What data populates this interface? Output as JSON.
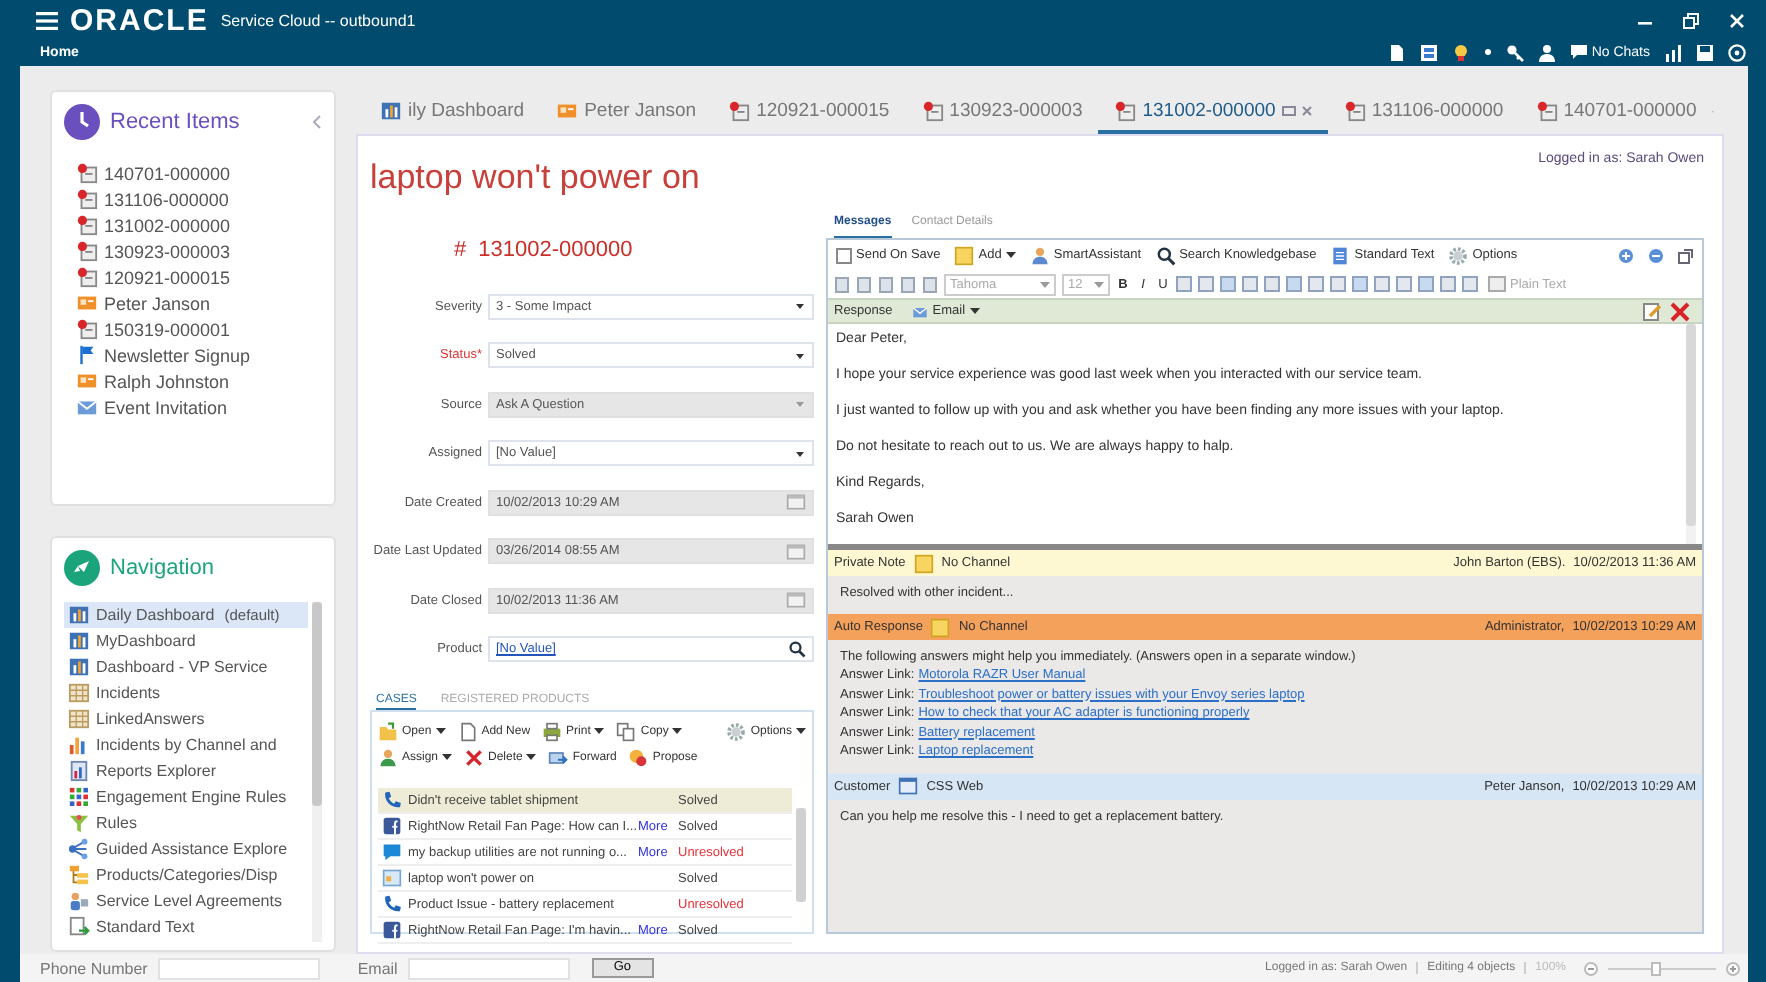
{
  "app": {
    "logo": "ORACLE",
    "title": "Service Cloud -- outbound1",
    "menu": "Home",
    "chat_status": "No Chats"
  },
  "recent_items": {
    "title": "Recent Items",
    "items": [
      {
        "kind": "incident",
        "label": "140701-000000"
      },
      {
        "kind": "incident",
        "label": "131106-000000"
      },
      {
        "kind": "incident",
        "label": "131002-000000"
      },
      {
        "kind": "incident",
        "label": "130923-000003"
      },
      {
        "kind": "incident",
        "label": "120921-000015"
      },
      {
        "kind": "contact",
        "label": "Peter Janson"
      },
      {
        "kind": "incident",
        "label": "150319-000001"
      },
      {
        "kind": "flag",
        "label": "Newsletter Signup"
      },
      {
        "kind": "contact",
        "label": "Ralph Johnston"
      },
      {
        "kind": "mail",
        "label": "Event Invitation"
      }
    ]
  },
  "navigation": {
    "title": "Navigation",
    "items": [
      {
        "kind": "dashboard",
        "label": "Daily Dashboard",
        "note": "(default)",
        "selected": true
      },
      {
        "kind": "dashboard",
        "label": "MyDashboard",
        "selected": false
      },
      {
        "kind": "dashboard",
        "label": "Dashboard - VP Service",
        "selected": false
      },
      {
        "kind": "table",
        "label": "Incidents",
        "selected": false
      },
      {
        "kind": "table",
        "label": "LinkedAnswers",
        "selected": false
      },
      {
        "kind": "chart",
        "label": "Incidents by Channel and",
        "selected": false
      },
      {
        "kind": "report",
        "label": "Reports Explorer",
        "selected": false
      },
      {
        "kind": "grid",
        "label": "Engagement Engine Rules",
        "selected": false
      },
      {
        "kind": "funnel",
        "label": "Rules",
        "selected": false
      },
      {
        "kind": "network",
        "label": "Guided Assistance Explore",
        "selected": false
      },
      {
        "kind": "hierarchy",
        "label": "Products/Categories/Disp",
        "selected": false
      },
      {
        "kind": "people",
        "label": "Service Level Agreements",
        "selected": false
      },
      {
        "kind": "textdoc",
        "label": "Standard Text",
        "selected": false
      }
    ]
  },
  "tabs": [
    {
      "kind": "dashboard",
      "label": "ily Dashboard",
      "selected": false
    },
    {
      "kind": "contact",
      "label": "Peter Janson",
      "selected": false
    },
    {
      "kind": "incident",
      "label": "120921-000015",
      "selected": false
    },
    {
      "kind": "incident",
      "label": "130923-000003",
      "selected": false
    },
    {
      "kind": "incident",
      "label": "131002-000000",
      "selected": true
    },
    {
      "kind": "incident",
      "label": "131106-000000",
      "selected": false
    },
    {
      "kind": "incident",
      "label": "140701-000000",
      "selected": false
    }
  ],
  "incident": {
    "subject": "laptop won't power on",
    "logged_in": "Logged in as: Sarah Owen",
    "number_mark": "#",
    "number": "131002-000000",
    "fields": [
      {
        "label": "Severity",
        "value": "3 - Some Impact",
        "kind": "select",
        "required": false,
        "disabled": false
      },
      {
        "label": "Status*",
        "value": "Solved",
        "kind": "select",
        "required": true,
        "disabled": false
      },
      {
        "label": "Source",
        "value": "Ask A Question",
        "kind": "select",
        "required": false,
        "disabled": true
      },
      {
        "label": "Assigned",
        "value": "[No Value]",
        "kind": "select",
        "required": false,
        "disabled": false
      },
      {
        "label": "Date Created",
        "value": "10/02/2013 10:29 AM",
        "kind": "date",
        "required": false,
        "disabled": true
      },
      {
        "label": "Date Last Updated",
        "value": "03/26/2014 08:55 AM",
        "kind": "date",
        "required": false,
        "disabled": true
      },
      {
        "label": "Date Closed",
        "value": "10/02/2013 11:36 AM",
        "kind": "date",
        "required": false,
        "disabled": true
      },
      {
        "label": "Product",
        "value": "[No Value]",
        "kind": "lookup",
        "required": false,
        "disabled": false
      }
    ]
  },
  "cases": {
    "tabs": [
      {
        "label": "CASES",
        "selected": true
      },
      {
        "label": "REGISTERED PRODUCTS",
        "selected": false
      }
    ],
    "toolbar": [
      [
        {
          "kind": "open",
          "label": "Open",
          "dropdown": true
        },
        {
          "kind": "new",
          "label": "Add New",
          "dropdown": false
        },
        {
          "kind": "print",
          "label": "Print",
          "dropdown": true
        },
        {
          "kind": "copy",
          "label": "Copy",
          "dropdown": true
        },
        {
          "kind": "options",
          "label": "Options",
          "dropdown": true
        }
      ],
      [
        {
          "kind": "assign",
          "label": "Assign",
          "dropdown": true
        },
        {
          "kind": "delete",
          "label": "Delete",
          "dropdown": true
        },
        {
          "kind": "forward",
          "label": "Forward",
          "dropdown": false
        },
        {
          "kind": "propose",
          "label": "Propose",
          "dropdown": false
        }
      ]
    ],
    "rows": [
      {
        "kind": "phone",
        "subject": "Didn't receive tablet shipment",
        "status": "Solved",
        "resolved": true,
        "selected": true
      },
      {
        "kind": "social",
        "subject": "RightNow Retail Fan Page: How can I...",
        "more": "More",
        "status": "Solved",
        "resolved": true,
        "selected": false
      },
      {
        "kind": "chat",
        "subject": "my backup utilities are not running o...",
        "more": "More",
        "status": "Unresolved",
        "resolved": false,
        "selected": false
      },
      {
        "kind": "web",
        "subject": "laptop won't power on",
        "status": "Solved",
        "resolved": true,
        "selected": false
      },
      {
        "kind": "phone",
        "subject": "Product Issue - battery replacement",
        "status": "Unresolved",
        "resolved": false,
        "selected": false
      },
      {
        "kind": "social",
        "subject": "RightNow Retail Fan Page: I'm havin...",
        "more": "More",
        "status": "Solved",
        "resolved": true,
        "selected": false
      }
    ]
  },
  "messages": {
    "tabs": [
      {
        "label": "Messages",
        "selected": true
      },
      {
        "label": "Contact Details",
        "selected": false
      }
    ],
    "send_on_save": {
      "label": "Send On Save",
      "checked": false
    },
    "toolbar": [
      {
        "kind": "add",
        "label": "Add",
        "dropdown": true
      },
      {
        "kind": "assistant",
        "label": "SmartAssistant",
        "dropdown": false
      },
      {
        "kind": "search",
        "label": "Search Knowledgebase",
        "dropdown": false
      },
      {
        "kind": "text",
        "label": "Standard Text",
        "dropdown": false
      },
      {
        "kind": "options",
        "label": "Options",
        "dropdown": false
      }
    ],
    "font": "Tahoma",
    "size": "12",
    "format_buttons": [
      "B",
      "I",
      "U"
    ],
    "plain_text": "Plain Text",
    "response_label": "Response",
    "channel": "Email",
    "editor": [
      "Dear Peter,",
      "I hope your service experience was good last week when you interacted with our service team.",
      "I just wanted to follow up with you and ask whether you have been finding any more issues with your laptop.",
      "Do not hesitate to reach out to us. We are always happy to halp.",
      "Kind Regards,",
      "Sarah Owen"
    ],
    "threads": [
      {
        "kind": "private_note",
        "type": "Private Note",
        "channel": "No Channel",
        "author": "John Barton (EBS).",
        "time": "10/02/2013 11:36 AM",
        "body": "Resolved with other incident..."
      },
      {
        "kind": "auto_response",
        "type": "Auto Response",
        "channel": "No Channel",
        "author": "Administrator,",
        "time": "10/02/2013 10:29 AM",
        "body": "The following answers might help you immediately. (Answers open in a separate window.)",
        "links": [
          {
            "prefix": "Answer Link:",
            "text": "Motorola RAZR User Manual"
          },
          {
            "prefix": "Answer Link:",
            "text": "Troubleshoot power or battery issues with your Envoy series laptop"
          },
          {
            "prefix": "Answer Link:",
            "text": "How to check that your AC adapter is functioning properly"
          },
          {
            "prefix": "Answer Link:",
            "text": "Battery replacement"
          },
          {
            "prefix": "Answer Link:",
            "text": "Laptop replacement"
          }
        ]
      },
      {
        "kind": "customer",
        "type": "Customer",
        "channel": "CSS Web",
        "author": "Peter Janson,",
        "time": "10/02/2013 10:29 AM",
        "body": "Can you help me resolve this - I need to get a replacement battery."
      }
    ]
  },
  "footer": {
    "phone_label": "Phone Number",
    "email_label": "Email",
    "go": "Go",
    "status": [
      "Logged in as: Sarah Owen",
      "Editing 4 objects"
    ],
    "zoom": {
      "reading": "100%",
      "level": 0.45
    }
  }
}
